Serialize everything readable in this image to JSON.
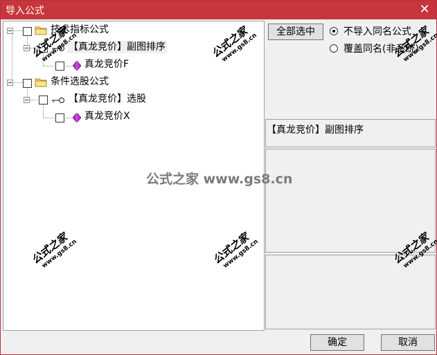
{
  "window": {
    "title": "导入公式",
    "close_glyph": "✕"
  },
  "tree": {
    "groups": [
      {
        "label": "技术指标公式",
        "children": [
          {
            "label": "【真龙竞价】副图排序",
            "selected": true,
            "children": [
              {
                "label": "真龙竞价F"
              }
            ]
          }
        ]
      },
      {
        "label": "条件选股公式",
        "children": [
          {
            "label": "【真龙竞价】选股",
            "children": [
              {
                "label": "真龙竞价X"
              }
            ]
          }
        ]
      }
    ]
  },
  "options": {
    "select_all": "全部选中",
    "radio_skip": "不导入同名公式",
    "radio_overwrite": "覆盖同名(非系统)",
    "selected_radio": "radio_skip"
  },
  "detail": {
    "formula_name": "【真龙竞价】副图排序"
  },
  "buttons": {
    "ok": "确定",
    "cancel": "取消"
  },
  "watermark": {
    "site_cn": "公式之家",
    "site_url": "www.gs8.cn",
    "center": "公式之家 www.gs8.cn"
  },
  "colors": {
    "titlebar": "#c8353c",
    "gem": "#b030c8"
  }
}
